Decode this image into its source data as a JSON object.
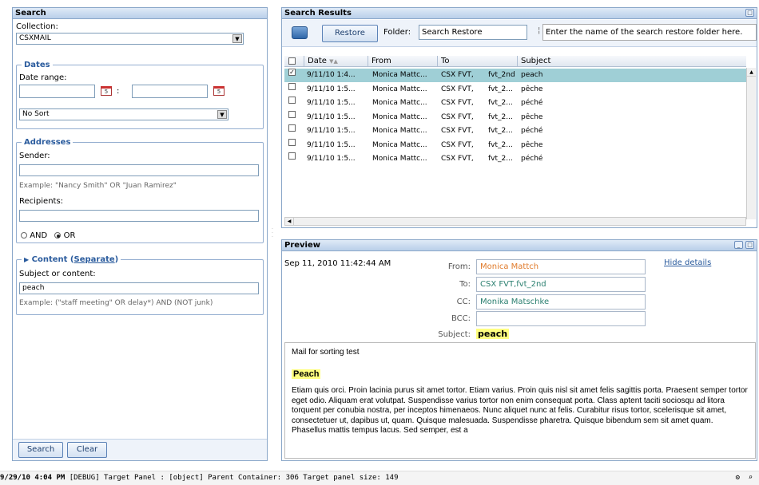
{
  "search": {
    "title": "Search",
    "collection_label": "Collection:",
    "collection_value": "CSXMAIL",
    "dates_legend": "Dates",
    "date_range_label": "Date range:",
    "date_separator": ":",
    "sort_value": "No Sort",
    "addresses_legend": "Addresses",
    "sender_label": "Sender:",
    "sender_example": "Example: \"Nancy Smith\" OR \"Juan Ramirez\"",
    "recipients_label": "Recipients:",
    "and_label": "AND",
    "or_label": "OR",
    "content_legend": "Content",
    "content_separate": "Separate",
    "subject_label": "Subject or content:",
    "subject_value": "peach",
    "subject_example": "Example: (\"staff meeting\" OR delay*) AND (NOT junk)",
    "search_button": "Search",
    "clear_button": "Clear"
  },
  "results": {
    "title": "Search Results",
    "restore_button": "Restore",
    "folder_label": "Folder:",
    "folder_value": "Search Restore",
    "folder_hint": "Enter the name of the search restore folder here.",
    "columns": {
      "date": "Date",
      "from": "From",
      "to": "To",
      "subject": "Subject"
    },
    "rows": [
      {
        "date": "9/11/10 1:4...",
        "from": "Monica Mattc...",
        "to": "CSX FVT,",
        "to2": "fvt_2nd",
        "subject": "peach",
        "checked": true
      },
      {
        "date": "9/11/10 1:5...",
        "from": "Monica Mattc...",
        "to": "CSX FVT,",
        "to2": "fvt_2...",
        "subject": "pêche",
        "checked": false
      },
      {
        "date": "9/11/10 1:5...",
        "from": "Monica Mattc...",
        "to": "CSX FVT,",
        "to2": "fvt_2...",
        "subject": "péché",
        "checked": false
      },
      {
        "date": "9/11/10 1:5...",
        "from": "Monica Mattc...",
        "to": "CSX FVT,",
        "to2": "fvt_2...",
        "subject": "pêche",
        "checked": false
      },
      {
        "date": "9/11/10 1:5...",
        "from": "Monica Mattc...",
        "to": "CSX FVT,",
        "to2": "fvt_2...",
        "subject": "péché",
        "checked": false
      },
      {
        "date": "9/11/10 1:5...",
        "from": "Monica Mattc...",
        "to": "CSX FVT,",
        "to2": "fvt_2...",
        "subject": "pêche",
        "checked": false
      },
      {
        "date": "9/11/10 1:5...",
        "from": "Monica Mattc...",
        "to": "CSX FVT,",
        "to2": "fvt_2...",
        "subject": "péché",
        "checked": false
      }
    ]
  },
  "preview": {
    "title": "Preview",
    "date": "Sep 11, 2010 11:42:44 AM",
    "from_label": "From:",
    "from_value": "Monica Mattch",
    "to_label": "To:",
    "to_value": "CSX FVT,fvt_2nd",
    "cc_label": "CC:",
    "cc_value": "Monika Matschke",
    "bcc_label": "BCC:",
    "bcc_value": "",
    "subject_label": "Subject:",
    "subject_value": "peach",
    "hide_details": "Hide details",
    "body_intro": "Mail for sorting test",
    "body_highlight": "Peach",
    "body_text": "Etiam quis orci. Proin lacinia purus sit amet tortor. Etiam varius. Proin quis nisl sit amet felis sagittis porta. Praesent semper tortor eget odio. Aliquam erat volutpat. Suspendisse varius tortor non enim consequat porta. Class aptent taciti sociosqu ad litora torquent per conubia nostra, per inceptos himenaeos. Nunc aliquet nunc at felis. Curabitur risus tortor, scelerisque sit amet, consectetuer ut, dapibus ut, quam. Quisque malesuada. Suspendisse pharetra. Quisque bibendum sem sit amet quam. Phasellus mattis tempus lacus. Sed semper, est a"
  },
  "status": {
    "timestamp": "9/29/10 4:04 PM",
    "message": "[DEBUG] Target Panel : [object] Parent Container: 306 Target panel size: 149"
  },
  "colors": {
    "panel_border": "#8aa7c9",
    "selected_row": "#9fcfd6",
    "from_text": "#e07a2a",
    "link": "#2a5b9d",
    "highlight": "#ffff80"
  }
}
